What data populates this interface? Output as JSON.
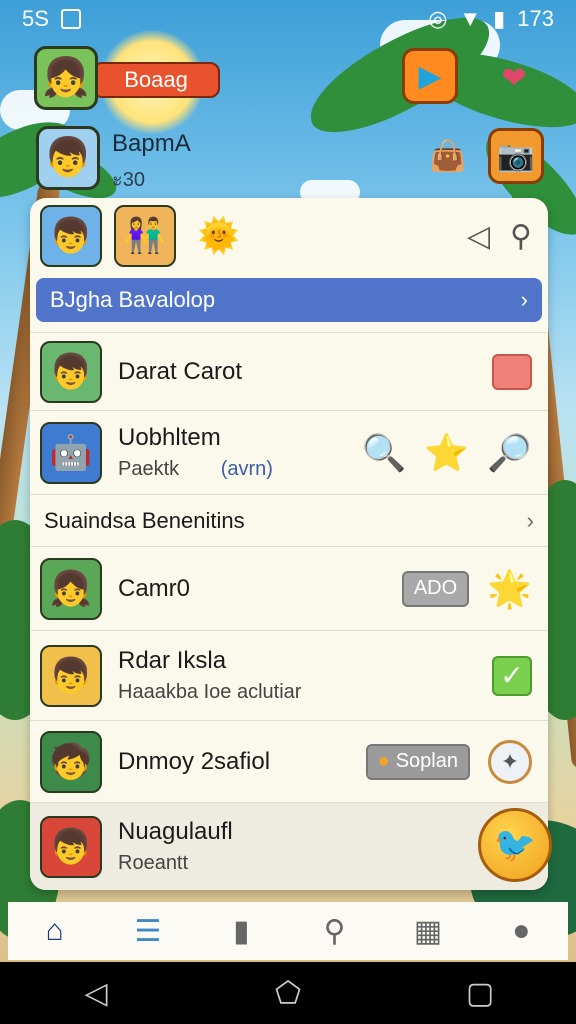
{
  "status_bar": {
    "left_time": "5S",
    "right_time": "173"
  },
  "header": {
    "name_pill": "Boaag",
    "profile_name": "BapmA",
    "profile_sub": "ะ30"
  },
  "panel": {
    "banner_title": "BJgha Bavalolop",
    "banner_chevron": "›",
    "rows": [
      {
        "title": "Darat Carot"
      },
      {
        "title": "Uobhltem",
        "sub": "Paektk",
        "sub_extra": "(avrn)"
      },
      {
        "title": "Camr0",
        "pill": "ADO"
      },
      {
        "title": "Rdar Iksla",
        "sub": "Haaakba Ioe aclutiar",
        "check": "✓"
      },
      {
        "title": "Dnmoy 2safiol",
        "pill": "Soplan"
      },
      {
        "title": "Nuagulaufl",
        "sub": "Roeantt"
      }
    ],
    "section_title": "Suaindsa Benenitins",
    "section_chevron": "›"
  },
  "icons": {
    "profile_avatar": "girl-avatar-icon",
    "user_avatar": "boy-avatar-icon",
    "play": "play-icon",
    "heart": "heart-icon",
    "search": "search-icon",
    "sound": "sound-icon"
  },
  "colors": {
    "banner": "#4f74c9",
    "pill": "#e8522d",
    "panel": "#fbf8ec",
    "fab": "#f0a020"
  }
}
